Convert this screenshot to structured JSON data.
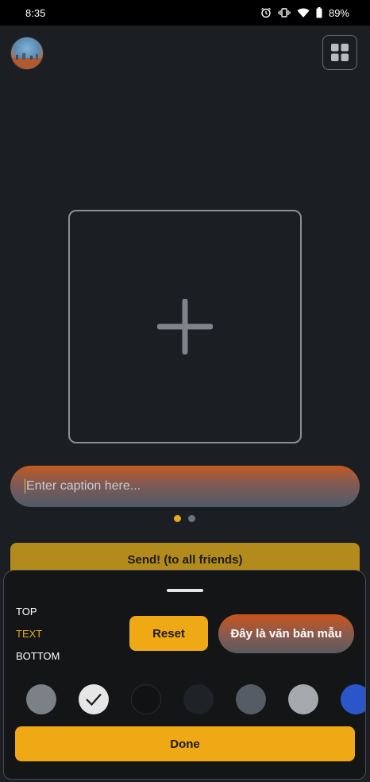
{
  "status": {
    "time": "8:35",
    "battery": "89%",
    "icons": [
      "alarm-icon",
      "vibrate-icon",
      "wifi-icon",
      "battery-icon"
    ]
  },
  "header": {
    "avatar": "user-avatar",
    "grid_icon": "grid-icon"
  },
  "add_media": {
    "icon": "plus-icon"
  },
  "caption": {
    "placeholder": "Enter caption here..."
  },
  "pager": {
    "count": 2,
    "active": 0
  },
  "send": {
    "label": "Send! (to all friends)"
  },
  "sheet": {
    "positions": [
      {
        "label": "TOP",
        "active": false
      },
      {
        "label": "TEXT",
        "active": true
      },
      {
        "label": "BOTTOM",
        "active": false
      }
    ],
    "reset_label": "Reset",
    "preview_text": "Đây là văn bản mẫu",
    "swatches": [
      {
        "color": "#7c8188",
        "selected": false
      },
      {
        "color": "#e6e6e6",
        "selected": true
      },
      {
        "color": "#111214",
        "selected": false
      },
      {
        "color": "#1f2226",
        "selected": false
      },
      {
        "color": "#555c65",
        "selected": false
      },
      {
        "color": "#a5a8ac",
        "selected": false
      },
      {
        "color": "#2a56c9",
        "selected": false
      }
    ],
    "done_label": "Done"
  },
  "colors": {
    "accent": "#efa914",
    "background": "#1b1e22",
    "sheet": "#141516"
  }
}
